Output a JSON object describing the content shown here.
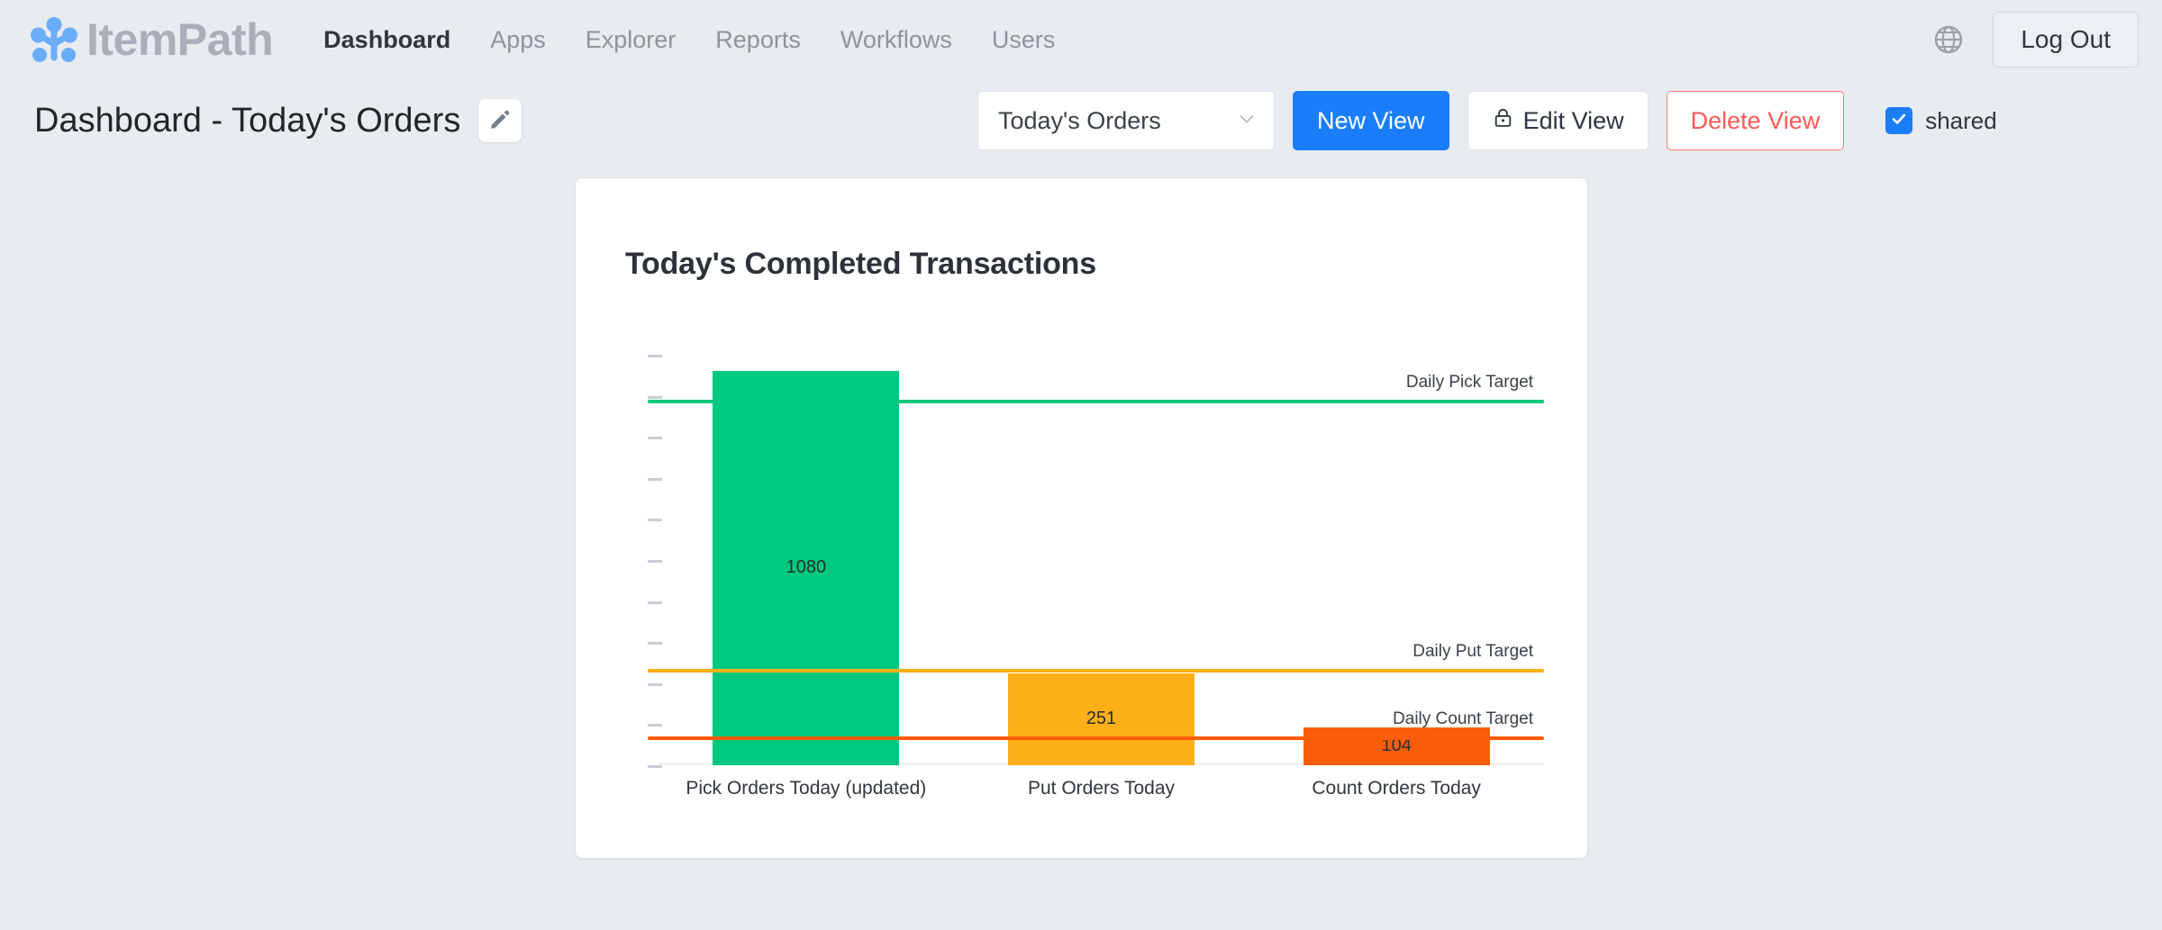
{
  "nav": {
    "brand": "ItemPath",
    "logo_icon": "itempath-dots-logo",
    "links": [
      {
        "label": "Dashboard",
        "active": true
      },
      {
        "label": "Apps",
        "active": false
      },
      {
        "label": "Explorer",
        "active": false
      },
      {
        "label": "Reports",
        "active": false
      },
      {
        "label": "Workflows",
        "active": false
      },
      {
        "label": "Users",
        "active": false
      }
    ],
    "language_icon": "globe-icon",
    "logout_label": "Log Out"
  },
  "viewbar": {
    "page_title": "Dashboard - Today's Orders",
    "edit_title_icon": "pencil-icon",
    "view_select_value": "Today's Orders",
    "view_select_caret_icon": "chevron-down-icon",
    "new_view_label": "New View",
    "edit_view_label": "Edit View",
    "edit_view_icon": "lock-icon",
    "delete_view_label": "Delete View",
    "shared_label": "shared",
    "shared_checked": true,
    "check_icon": "check-icon"
  },
  "colors": {
    "accent_blue": "#1a7efb",
    "danger_red": "#ff5a55",
    "pick_green": "#00c97f",
    "put_amber": "#fcaf17",
    "count_orange": "#fa5d0a",
    "page_bg": "#e8ebef",
    "card_bg": "#ffffff"
  },
  "chart_data": {
    "type": "bar",
    "title": "Today's Completed Transactions",
    "xlabel": "",
    "ylabel": "",
    "grid": false,
    "legend": "none",
    "ylim": [
      0,
      1140
    ],
    "ytick_count": 11,
    "categories": [
      "Pick Orders Today (updated)",
      "Put Orders Today",
      "Count Orders Today"
    ],
    "values": [
      1080,
      251,
      104
    ],
    "value_labels": [
      "1080",
      "251",
      "104"
    ],
    "bar_colors": [
      "#00c97f",
      "#fcaf17",
      "#fa5d0a"
    ],
    "reference_lines": [
      {
        "label": "Daily Pick Target",
        "value": 1003,
        "color": "#00c97f"
      },
      {
        "label": "Daily Put Target",
        "value": 265,
        "color": "#fcaf17"
      },
      {
        "label": "Daily Count Target",
        "value": 78,
        "color": "#fa5d0a"
      }
    ]
  }
}
